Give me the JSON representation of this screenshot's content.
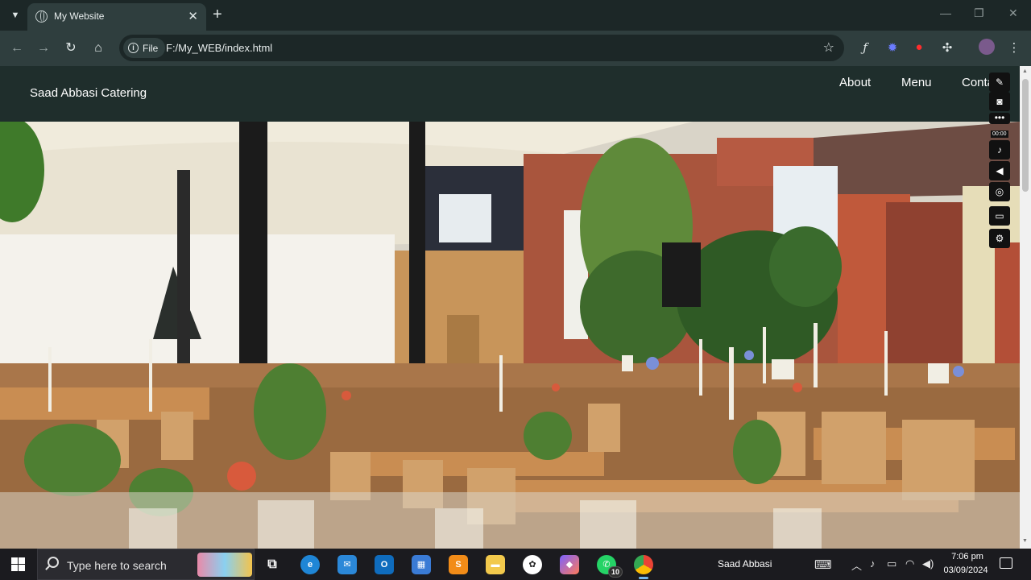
{
  "browser": {
    "tab_title": "My Website",
    "chip_label": "File",
    "url": "F:/My_WEB/index.html",
    "new_tab": "+",
    "tab_close": "✕"
  },
  "site": {
    "brand": "Saad Abbasi Catering",
    "nav": {
      "about": "About",
      "menu": "Menu",
      "contact": "Contact"
    }
  },
  "recorder": {
    "timer": "00:00"
  },
  "taskbar": {
    "search_placeholder": "Type here to search",
    "user": "Saad Abbasi",
    "time": "7:06 pm",
    "date": "03/09/2024",
    "whatsapp_badge": "10"
  },
  "colors": {
    "chrome_dark": "#1c2727",
    "chrome_toolbar": "#2f3e3e",
    "site_nav": "#1f2e2c",
    "taskbar": "#1b1b1f"
  }
}
